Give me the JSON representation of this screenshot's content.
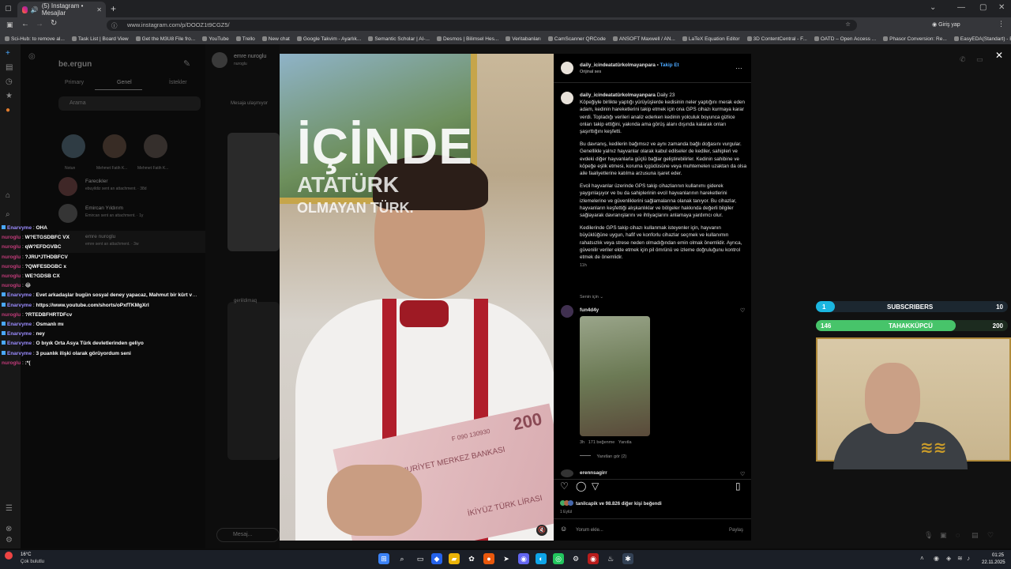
{
  "browser": {
    "tab_title": "(5) Instagram • Mesajlar",
    "new_tab": "+",
    "url": "www.instagram.com/p/DOOZ1t9CGZ5/",
    "profile_label": "Giriş yap",
    "bookmarks": [
      "Sci-Hub: to remove al...",
      "Task List | Board View",
      "Get the M3U8 File fro...",
      "YouTube",
      "Trello",
      "New chat",
      "Google Takvim - Ayarlık...",
      "Semantic Scholar | AI-...",
      "Desmos | Bilimsel Hes...",
      "Veritabanları",
      "CamScanner QRCode",
      "ANSOFT Maxwell / AN...",
      "LaTeX Equation Editor",
      "3D ContentCentral - F...",
      "OATD – Open Access ...",
      "Phasor Conversion: Re...",
      "EasyEDA(Standart) - B..."
    ]
  },
  "dm": {
    "username": "be.ergun",
    "tabs": [
      "Primary",
      "Genel",
      "İstekler"
    ],
    "search_placeholder": "Arama",
    "stories": [
      "Notun",
      "Mehmet Fatih K...",
      "Mehmet Fatih K..."
    ],
    "threads": [
      {
        "name": "Farecikler",
        "preview": "ebuyildiz sent an attachment. · 38d"
      },
      {
        "name": "Emircan Yıldırım",
        "preview": "Emircan sent an attachment. · 1y"
      },
      {
        "name": "emre nuroglu",
        "preview": "emre sent an attachment. · 3w"
      }
    ],
    "conv_name": "emre nuroglu",
    "conv_sub": "nuroglu",
    "request_text": "Mesaja ulaşmıyor",
    "conv2_name": "geriildimaq",
    "message_placeholder": "Mesaj..."
  },
  "stream_chat": [
    {
      "user": "Enarvyme",
      "text": "OHA"
    },
    {
      "user": "nuroglu",
      "text": "W?ETGSDBFC VX"
    },
    {
      "user": "nuroglu",
      "text": "qW?EFDGVBC"
    },
    {
      "user": "nuroglu",
      "text": "?JRU*JTHDBFCV"
    },
    {
      "user": "nuroglu",
      "text": "?QWFESDGBC x"
    },
    {
      "user": "nuroglu",
      "text": "WE?GDSB CX"
    },
    {
      "user": "nuroglu",
      "text": "😂"
    },
    {
      "user": "Enarvyme",
      "text": "Evet arkadaşlar bugün sosyal deney yapacaz, Mahmut bir kürt vatandaşı oynayacak ben ise normal bir vatandaşı"
    },
    {
      "user": "Enarvyme",
      "text": "https://www.youtube.com/shorts/oPxfTKMgXrI"
    },
    {
      "user": "nuroglu",
      "text": "?RTEDBFHRTDFcv"
    },
    {
      "user": "Enarvyme",
      "text": "Osmanlı mı"
    },
    {
      "user": "Enarvyme",
      "text": "ney"
    },
    {
      "user": "Enarvyme",
      "text": "O bıyık Orta Asya Türk devletlerinden geliyo"
    },
    {
      "user": "Enarvyme",
      "text": "3 puanlık ilişki olarak görüyordum seni"
    },
    {
      "user": "nuroglu",
      "text": ":*("
    }
  ],
  "video": {
    "line1": "İÇİNDE",
    "line2": "ATATÜRK",
    "line3": "OLMAYAN TÜRK.",
    "banknote_text": "TÜRKİYE CUMHURİYET MERKEZ BANKASI",
    "banknote_serial": "F 090 130930",
    "banknote_value": "200",
    "banknote_lira": "İKİYÜZ TÜRK LİRASI"
  },
  "post": {
    "author": "daily_icindeatatürkolmayanpara",
    "follow": "Takip Et",
    "audio": "Orijinal ses",
    "caption_author": "daily_icindeatatürkolmayanpara",
    "caption_title": "Daily 23",
    "caption": [
      "Köpeğiyle birlikte yaptığı yürüyüşlerde kedisinin neler yaptığını merak eden adam, kedinin hareketlerini takip etmek için ona GPS cihazı kurmaya karar verdi. Topladığı verileri analiz ederken kedinin yolculuk boyunca gizlice onları takip ettiğini, yakında ama görüş alanı dışında kalarak onları şaşırttığını keşfetti.",
      "Bu davranış, kedilerin bağımsız ve aynı zamanda bağlı doğasını vurgular. Genellikle yalnız hayvanlar olarak kabul edilseler de kediler, sahipleri ve evdeki diğer hayvanlarla güçlü bağlar geliştirebilirler. Kedinin sahibine ve köpeğe eşlik etmesi, koruma içgüdüsüne veya muhtemelen uzaktan da olsa aile faaliyetlerine katılma arzusuna işaret eder.",
      "Evcil hayvanlar üzerinde GPS takip cihazlarının kullanımı giderek yaygınlaşıyor ve bu da sahiplerinin evcil hayvanlarının hareketlerini izlemelerine ve güvenliklerini sağlamalarına olanak tanıyor. Bu cihazlar, hayvanların keşfettiği alışkanlıklar ve bölgeler hakkında değerli bilgiler sağlayarak davranışlarını ve ihtiyaçlarını anlamaya yardımcı olur.",
      "Kedilerinde GPS takip cihazı kullanmak isteyenler için, hayvanın büyüklüğüne uygun, hafif ve konforlu cihazlar seçmek ve kullanımın rahatsızlık veya strese neden olmadığından emin olmak önemlidir. Ayrıca, güvenilir veriler elde etmek için pil ömrünü ve izleme doğruluğunu kontrol etmek de önemlidir."
    ],
    "caption_time": "11h",
    "for_you": "Senin için",
    "comment1_user": "fun4d4y",
    "comment1_meta_time": "3h",
    "comment1_likes": "171 beğenme",
    "comment1_reply": "Yanıtla",
    "view_replies": "Yanıtları gör (2)",
    "comment2_user": "erennsagirr",
    "likes_text": "tanilcapik ve 98.826 diğer kişi beğendi",
    "date": "1 Eylül",
    "comment_placeholder": "Yorum ekle...",
    "share": "Paylaş"
  },
  "overlays": {
    "subs_label": "SUBSCRIBERS",
    "subs_current": "1",
    "subs_goal": "10",
    "subs_progress": 0.1,
    "tah_label": "TAHAKKÜPCÜ",
    "tah_current": "146",
    "tah_goal": "200",
    "tah_progress": 0.73
  },
  "taskbar": {
    "weather_temp": "16°C",
    "weather_desc": "Çok bulutlu",
    "time": "01:25",
    "date": "22.11.2025"
  }
}
